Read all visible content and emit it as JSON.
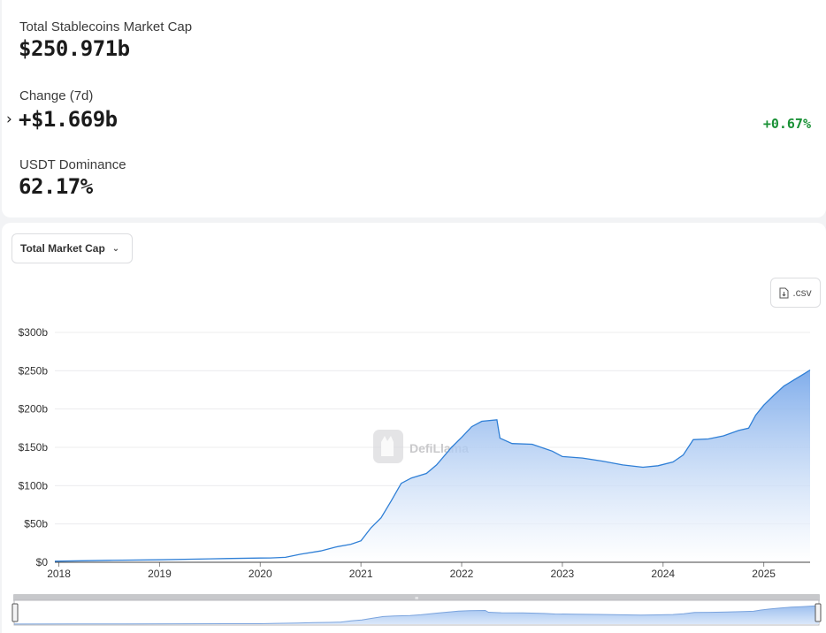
{
  "stats": {
    "market_cap_label": "Total Stablecoins Market Cap",
    "market_cap_value": "$250.971b",
    "change_label": "Change (7d)",
    "change_value": "+$1.669b",
    "change_pct": "+0.67%",
    "dominance_label": "USDT Dominance",
    "dominance_value": "62.17%",
    "expand_icon": "chevron-right-icon"
  },
  "controls": {
    "dropdown_label": "Total Market Cap",
    "dropdown_icon": "chevron-down-icon",
    "csv_label": ".csv",
    "csv_icon": "download-file-icon"
  },
  "watermark": "DefiLlama",
  "colors": {
    "line": "#2f7fd6",
    "fill_top": "#7aa9ea",
    "fill_bottom": "#ffffff",
    "positive": "#1a9136"
  },
  "chart_data": {
    "type": "area",
    "xlabel": "",
    "ylabel": "",
    "x_ticks": [
      "2018",
      "2019",
      "2020",
      "2021",
      "2022",
      "2023",
      "2024",
      "2025"
    ],
    "y_ticks": [
      "$0",
      "$50b",
      "$100b",
      "$150b",
      "$200b",
      "$250b",
      "$300b"
    ],
    "ylim": [
      0,
      300
    ],
    "xlim": [
      2017.96,
      2025.46
    ],
    "grid": true,
    "series": [
      {
        "values_unit": "billions USD",
        "points": [
          [
            2017.96,
            1.4
          ],
          [
            2018.5,
            2.5
          ],
          [
            2019.0,
            3.2
          ],
          [
            2019.5,
            4.5
          ],
          [
            2020.0,
            5.5
          ],
          [
            2020.1,
            5.6
          ],
          [
            2020.25,
            6.5
          ],
          [
            2020.4,
            10.5
          ],
          [
            2020.6,
            14.8
          ],
          [
            2020.75,
            20.0
          ],
          [
            2020.9,
            23.5
          ],
          [
            2021.0,
            28.0
          ],
          [
            2021.1,
            45.0
          ],
          [
            2021.2,
            58.0
          ],
          [
            2021.3,
            80.0
          ],
          [
            2021.4,
            103.0
          ],
          [
            2021.5,
            110.0
          ],
          [
            2021.65,
            116.0
          ],
          [
            2021.75,
            127.0
          ],
          [
            2021.9,
            150.0
          ],
          [
            2022.0,
            163.0
          ],
          [
            2022.1,
            177.0
          ],
          [
            2022.2,
            184.0
          ],
          [
            2022.35,
            186.0
          ],
          [
            2022.38,
            162.0
          ],
          [
            2022.5,
            155.0
          ],
          [
            2022.7,
            154.0
          ],
          [
            2022.9,
            145.0
          ],
          [
            2023.0,
            138.0
          ],
          [
            2023.2,
            136.0
          ],
          [
            2023.4,
            132.0
          ],
          [
            2023.6,
            127.0
          ],
          [
            2023.8,
            124.0
          ],
          [
            2023.95,
            126.0
          ],
          [
            2024.1,
            131.0
          ],
          [
            2024.2,
            140.0
          ],
          [
            2024.3,
            160.0
          ],
          [
            2024.45,
            161.0
          ],
          [
            2024.6,
            165.0
          ],
          [
            2024.75,
            172.0
          ],
          [
            2024.85,
            175.0
          ],
          [
            2024.92,
            192.0
          ],
          [
            2025.0,
            205.0
          ],
          [
            2025.1,
            218.0
          ],
          [
            2025.2,
            230.0
          ],
          [
            2025.3,
            238.0
          ],
          [
            2025.4,
            246.0
          ],
          [
            2025.46,
            251.0
          ]
        ]
      }
    ]
  }
}
